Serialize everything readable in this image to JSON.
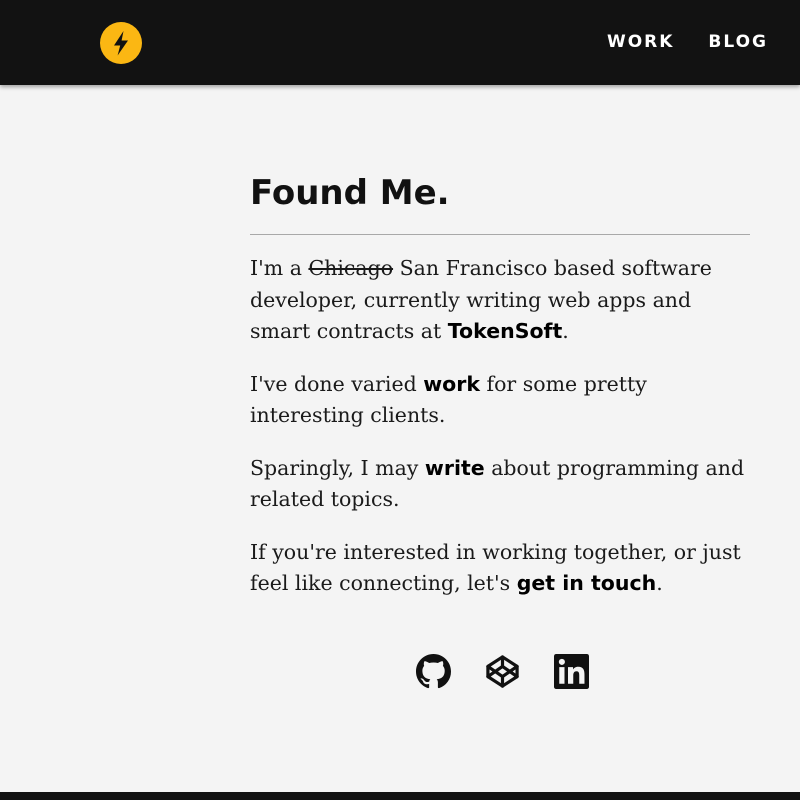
{
  "header": {
    "nav": [
      {
        "label": "WORK"
      },
      {
        "label": "BLOG"
      }
    ],
    "logo_icon": "lightning-bolt-icon",
    "accent_color": "#fbb713",
    "background_color": "#121212"
  },
  "main": {
    "title": "Found Me.",
    "p1": {
      "pre": "I'm a ",
      "struck": "Chicago",
      "mid": " San Francisco based software developer, currently writing web apps and smart contracts at ",
      "link": "TokenSoft",
      "post": "."
    },
    "p2": {
      "pre": "I've done varied ",
      "link": "work",
      "post": " for some pretty interesting clients."
    },
    "p3": {
      "pre": "Sparingly, I may ",
      "link": "write",
      "post": " about programming and related topics."
    },
    "p4": {
      "pre": "If you're interested in working together, or just feel like connecting, let's ",
      "link": "get in touch",
      "post": "."
    }
  },
  "social": [
    {
      "icon": "github-icon"
    },
    {
      "icon": "codepen-icon"
    },
    {
      "icon": "linkedin-icon"
    }
  ]
}
